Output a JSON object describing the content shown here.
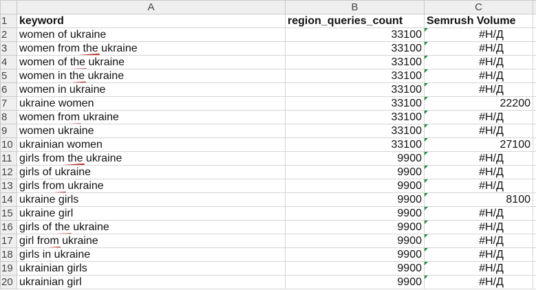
{
  "columns": [
    "A",
    "B",
    "C"
  ],
  "header": {
    "row_number": "1",
    "keyword": "keyword",
    "region_queries_count": "region_queries_count",
    "semrush_volume": "Semrush Volume"
  },
  "rows": [
    {
      "n": "2",
      "keyword": "women of ukraine",
      "count": "33100",
      "volume": "#Н/Д",
      "volume_is_error": true,
      "highlight": "of"
    },
    {
      "n": "3",
      "keyword": "women from the ukraine",
      "count": "33100",
      "volume": "#Н/Д",
      "volume_is_error": true,
      "highlight": "from the"
    },
    {
      "n": "4",
      "keyword": "women of the ukraine",
      "count": "33100",
      "volume": "#Н/Д",
      "volume_is_error": true,
      "highlight": "of the"
    },
    {
      "n": "5",
      "keyword": "women in the ukraine",
      "count": "33100",
      "volume": "#Н/Д",
      "volume_is_error": true,
      "highlight": "in the"
    },
    {
      "n": "6",
      "keyword": "women in ukraine",
      "count": "33100",
      "volume": "#Н/Д",
      "volume_is_error": true,
      "highlight": "in"
    },
    {
      "n": "7",
      "keyword": "ukraine women",
      "count": "33100",
      "volume": "22200",
      "volume_is_error": false,
      "highlight": ""
    },
    {
      "n": "8",
      "keyword": "women from ukraine",
      "count": "33100",
      "volume": "#Н/Д",
      "volume_is_error": true,
      "highlight": "from"
    },
    {
      "n": "9",
      "keyword": "women ukraine",
      "count": "33100",
      "volume": "#Н/Д",
      "volume_is_error": true,
      "highlight": ""
    },
    {
      "n": "10",
      "keyword": "ukrainian women",
      "count": "33100",
      "volume": "27100",
      "volume_is_error": false,
      "highlight": ""
    },
    {
      "n": "11",
      "keyword": "girls from the ukraine",
      "count": "9900",
      "volume": "#Н/Д",
      "volume_is_error": true,
      "highlight": "from the"
    },
    {
      "n": "12",
      "keyword": "girls of ukraine",
      "count": "9900",
      "volume": "#Н/Д",
      "volume_is_error": true,
      "highlight": "of"
    },
    {
      "n": "13",
      "keyword": "girls from ukraine",
      "count": "9900",
      "volume": "#Н/Д",
      "volume_is_error": true,
      "highlight": "from"
    },
    {
      "n": "14",
      "keyword": "ukraine girls",
      "count": "9900",
      "volume": "8100",
      "volume_is_error": false,
      "highlight": ""
    },
    {
      "n": "15",
      "keyword": "ukraine girl",
      "count": "9900",
      "volume": "#Н/Д",
      "volume_is_error": true,
      "highlight": ""
    },
    {
      "n": "16",
      "keyword": "girls of the ukraine",
      "count": "9900",
      "volume": "#Н/Д",
      "volume_is_error": true,
      "highlight": "of the"
    },
    {
      "n": "17",
      "keyword": "girl from ukraine",
      "count": "9900",
      "volume": "#Н/Д",
      "volume_is_error": true,
      "highlight": "from"
    },
    {
      "n": "18",
      "keyword": "girls in ukraine",
      "count": "9900",
      "volume": "#Н/Д",
      "volume_is_error": true,
      "highlight": "in"
    },
    {
      "n": "19",
      "keyword": "ukrainian girls",
      "count": "9900",
      "volume": "#Н/Д",
      "volume_is_error": true,
      "highlight": ""
    },
    {
      "n": "20",
      "keyword": "ukrainian girl",
      "count": "9900",
      "volume": "#Н/Д",
      "volume_is_error": true,
      "highlight": ""
    }
  ],
  "colors": {
    "highlight_underline": "#c0221a",
    "error_indicator": "#1e8c3a",
    "header_bg": "#efefef",
    "gridline": "#d4d4d4"
  }
}
